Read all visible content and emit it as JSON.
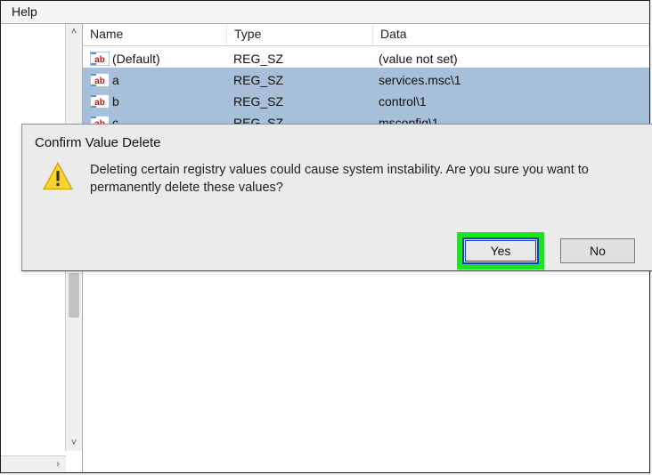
{
  "menu": {
    "help": "Help"
  },
  "columns": {
    "name": "Name",
    "type": "Type",
    "data": "Data"
  },
  "rows": [
    {
      "name": "(Default)",
      "type": "REG_SZ",
      "data": "(value not set)",
      "selected": false
    },
    {
      "name": "a",
      "type": "REG_SZ",
      "data": "services.msc\\1",
      "selected": true
    },
    {
      "name": "b",
      "type": "REG_SZ",
      "data": "control\\1",
      "selected": true
    },
    {
      "name": "c",
      "type": "REG_SZ",
      "data": "msconfig\\1",
      "selected": true
    }
  ],
  "dialog": {
    "title": "Confirm Value Delete",
    "message": "Deleting certain registry values could cause system instability. Are you sure you want to permanently delete these values?",
    "yes": "Yes",
    "no": "No"
  }
}
